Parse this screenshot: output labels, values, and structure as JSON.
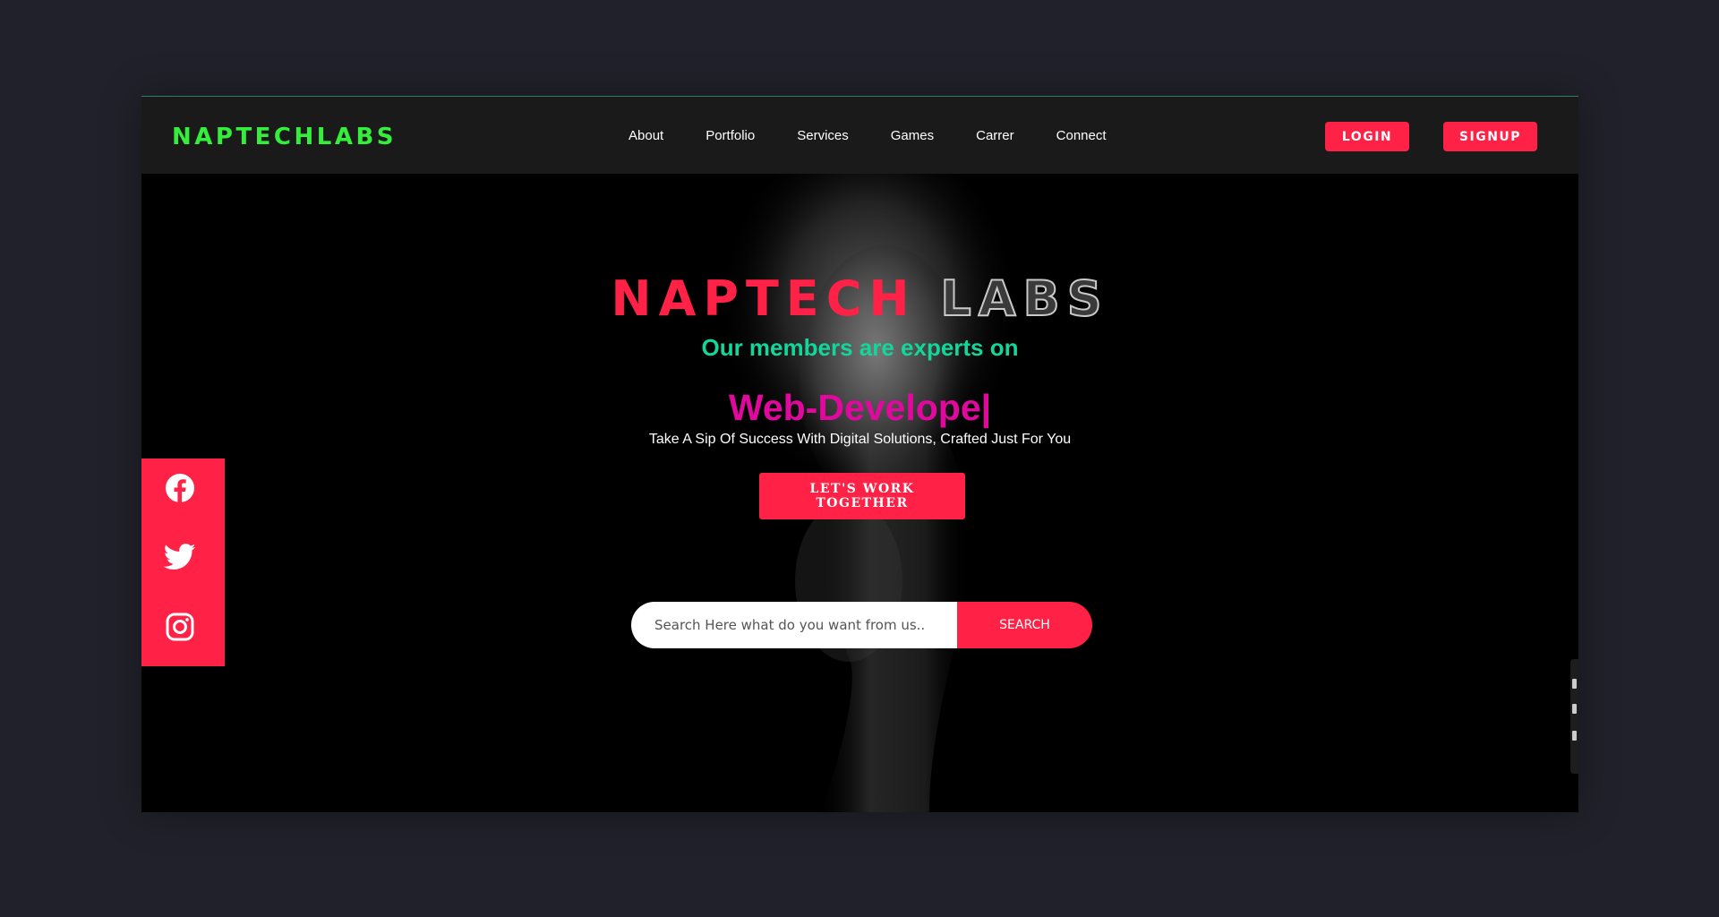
{
  "brand": {
    "logo": "NAPTECHLABS"
  },
  "nav": {
    "links": [
      "About",
      "Portfolio",
      "Services",
      "Games",
      "Carrer",
      "Connect"
    ],
    "login": "LOGIN",
    "signup": "SIGNUP"
  },
  "hero": {
    "title_part1": "NAPTECH",
    "title_part2": "LABS",
    "subtitle": "Our members are experts on",
    "typed_text": "Web-Develope|",
    "tagline": "Take A Sip Of Success With Digital Solutions, Crafted Just For You",
    "cta": "LET'S WORK TOGETHER"
  },
  "search": {
    "placeholder": "Search Here what do you want from us..",
    "button": "SEARCH"
  },
  "social": {
    "icons": [
      "facebook-icon",
      "twitter-icon",
      "instagram-icon"
    ],
    "accent": "#ff2146"
  },
  "colors": {
    "page_bg": "#20212a",
    "navbar_bg": "#1a1a1a",
    "logo": "#35ee3b",
    "accent": "#ff2146",
    "subtitle": "#12d69a",
    "typed": "#e0089d"
  }
}
